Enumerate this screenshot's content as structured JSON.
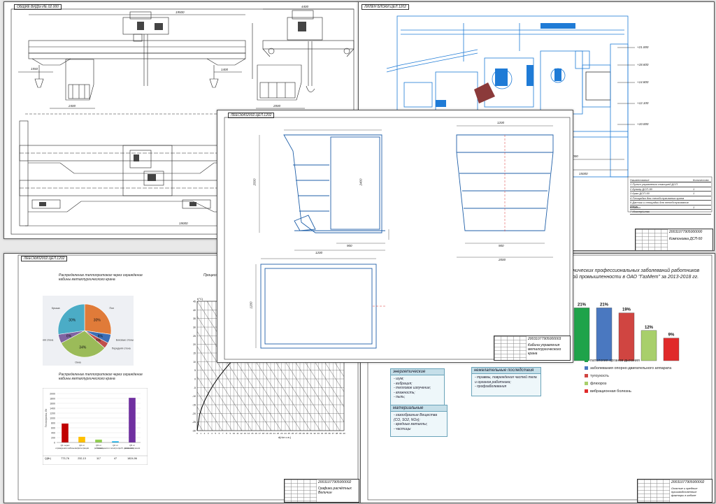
{
  "sheets": {
    "crane": {
      "code": "ОБЩИЕ ВИДЫ ИЕ.02.000"
    },
    "shop": {
      "code": "ЛИЛЕН БЛОКИ.ЦЕЛ.1202"
    },
    "cabin": {
      "code": "ЛЕЕСКИ02002.ЦЕЛ.1202"
    },
    "charts": {
      "code": "ЛЕЕСКИ02002.ЦЕЛ.1202"
    }
  },
  "crane_dims": {
    "d1": "19500",
    "d2": "1550",
    "d3": "4400",
    "d4": "19500",
    "d5": "1400",
    "d6": "9500",
    "d7": "2000",
    "d8": "2400",
    "d9": "19000",
    "d10": "2000"
  },
  "cabin_dims": {
    "w_top": "1200",
    "h_total": "2500",
    "w_bottom": "1200",
    "h_side": "2400",
    "frame": "900",
    "w_front": "2000",
    "w_plan": "1200",
    "w_right": "1800",
    "d_small": "450"
  },
  "shop_marks": {
    "m1": "+21.000",
    "m2": "+18.600",
    "m3": "+14.800",
    "m4": "+12.100",
    "m5": "+10.000",
    "m6": "±0.000",
    "m7": "6000",
    "m8": "15000"
  },
  "shop_table": {
    "header_a": "Наименование",
    "header_b": "Количество",
    "rows": [
      {
        "name": "Пульт управления станцией ДСП",
        "qty": ""
      },
      {
        "name": "Бункер ДСП-50",
        "qty": "1"
      },
      {
        "name": "Кран ДСП-50",
        "qty": "1"
      },
      {
        "name": "Площадка для техобслуживания крана",
        "qty": ""
      },
      {
        "name": "Датчик и площадки для техобслуживания крана",
        "qty": ""
      },
      {
        "name": "Бадьи",
        "qty": "1"
      },
      {
        "name": "Миксер/шлак",
        "qty": ""
      }
    ]
  },
  "stamps": {
    "shop": {
      "code": "20031077905000000",
      "name": "Компоновка ДСП-50",
      "org": "Кафедра «Безопасность жизнедеятельности»"
    },
    "cabin": {
      "code": "20031077905000003",
      "name": "Кабина управления металлургического крана",
      "org": "Кафедра «Безопасность жизнедеятельности»"
    },
    "charts": {
      "code": "20031077905000002",
      "name": "Графики расчётных Величин",
      "org": "Кафедра «Безопасность жизнедеятельности»"
    },
    "right": {
      "code": "20031077905000002",
      "name": "Опасные и вредные производственные факторы в кабине",
      "org": "Кафедра «Безопасность жизнедеятельности»"
    }
  },
  "pie": {
    "title": "Распределение теплопритоков через ограждение кабины металлургического крана",
    "slices": [
      {
        "label": "Пол",
        "pct": 30,
        "color": "#e07b39"
      },
      {
        "label": "Боковые стены",
        "pct": 6,
        "color": "#3b6fb6"
      },
      {
        "label": "Передняя стена",
        "pct": 4,
        "color": "#c0504d"
      },
      {
        "label": "Окна",
        "pct": 34,
        "color": "#9bbb59"
      },
      {
        "label": "Задняя стена",
        "pct": 6,
        "color": "#8064a2"
      },
      {
        "label": "Крыша",
        "pct": 30,
        "color": "#4bacc6"
      }
    ]
  },
  "bar_small": {
    "title": "Распределение теплопритоков через ограждение кабины металлургического крана",
    "ylabel": "Теплоприток, Вт",
    "legend": "Q(Вт)",
    "ylim": [
      0,
      2000
    ],
    "ticks": [
      "2000",
      "1800",
      "1600",
      "1400",
      "1200",
      "1000",
      "800",
      "600",
      "400",
      "200",
      "0"
    ],
    "categories": [
      "Q1 через ограждения кабины",
      "Q2 от инфильтрации",
      "Q3 от рабочего",
      "Q4 от освещения и электроприб. движения",
      "Q5 от теплоизлучения"
    ],
    "values": [
      "773,76",
      "232,13",
      "117",
      "47",
      "1824,96"
    ],
    "nums": [
      773.76,
      232.13,
      117,
      47,
      1824.96
    ],
    "colors": [
      "#c00000",
      "#ffc000",
      "#92d050",
      "#00b0f0",
      "#7030a0"
    ]
  },
  "idiagram": {
    "title": "Процесс обработки",
    "ylabel": "t(°C)",
    "xlabel": "d(г/кг с.в.)",
    "yticks": [
      "45",
      "40",
      "35",
      "30",
      "25",
      "20",
      "15",
      "10",
      "5",
      "0",
      "-5",
      "-10",
      "-15",
      "-20",
      "-25",
      "-30"
    ],
    "xticks": [
      "0",
      "1",
      "2",
      "3",
      "4",
      "5",
      "6",
      "7",
      "8",
      "9",
      "10",
      "11",
      "12",
      "13",
      "14",
      "15",
      "16",
      "17",
      "18",
      "19",
      "20",
      "21",
      "22",
      "23",
      "24",
      "25",
      "26",
      "27",
      "28",
      "29",
      "30",
      "31",
      "32",
      "33",
      "34",
      "35",
      "36",
      "37",
      "38",
      "39",
      "40"
    ]
  },
  "disease_chart": {
    "title_l1": "хронических профессиональных заболеваний работников",
    "title_l2": "еской промышленности в ОАО \"ГазМет\" за 2013-2018 гг.",
    "categories": [
      "патология органов дыхания",
      "заболевания опорно-двигательного аппарата",
      "тугоухость",
      "флюороз",
      "вибрационная болезнь"
    ],
    "labels": [
      "21%",
      "21%",
      "19%",
      "12%",
      "9%"
    ],
    "values": [
      21,
      21,
      19,
      12,
      9
    ],
    "colors": [
      "#1fa34a",
      "#4a78c0",
      "#d04541",
      "#a8cf6b",
      "#e02a2a"
    ]
  },
  "factor_boxes": {
    "energy": {
      "title": "энергетические",
      "items": [
        "- шум;",
        "- вибрация;",
        "- тепловое излучение;",
        "- влажность;",
        "- пыль;"
      ]
    },
    "material": {
      "title": "материальные",
      "items": [
        "- газообразные Вещества (CO, SO2, NOx);",
        "- вредные металлы;",
        "- частицы"
      ]
    },
    "consequences": {
      "title": "нежелательные последствия",
      "items": [
        "- травмы, повреждения частей тела и органов работника;",
        "- профзаболевания"
      ]
    }
  }
}
